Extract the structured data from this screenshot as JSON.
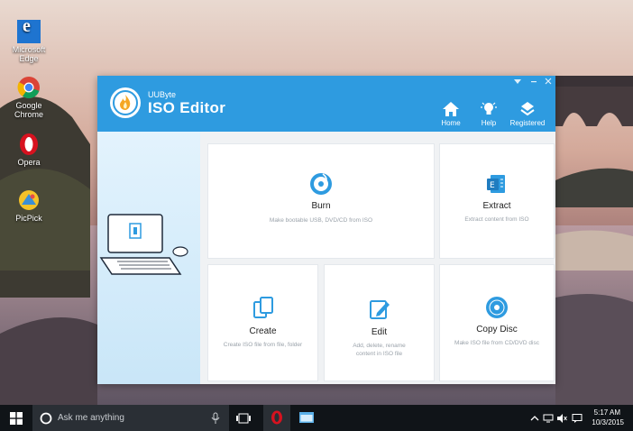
{
  "desktop": {
    "icons": [
      {
        "label": "Microsoft Edge"
      },
      {
        "label": "Google Chrome"
      },
      {
        "label": "Opera"
      },
      {
        "label": "PicPick"
      }
    ]
  },
  "app": {
    "brand_small": "UUByte",
    "title": "ISO Editor",
    "nav": [
      {
        "label": "Home",
        "icon": "home-icon"
      },
      {
        "label": "Help",
        "icon": "lightbulb-icon"
      },
      {
        "label": "Registered",
        "icon": "registered-icon"
      }
    ],
    "cards": {
      "burn": {
        "title": "Burn",
        "desc": "Make bootable USB, DVD/CD from ISO"
      },
      "extract": {
        "title": "Extract",
        "desc": "Extract content from ISO"
      },
      "create": {
        "title": "Create",
        "desc": "Create ISO file from file, folder"
      },
      "edit": {
        "title": "Edit",
        "desc1": "Add, delete, rename",
        "desc2": "content in ISO file"
      },
      "copy": {
        "title": "Copy Disc",
        "desc": "Make ISO file from CD/DVD disc"
      }
    },
    "colors": {
      "accent": "#2e9be0"
    }
  },
  "taskbar": {
    "search_placeholder": "Ask me anything",
    "time": "5:17 AM",
    "date": "10/3/2015"
  }
}
